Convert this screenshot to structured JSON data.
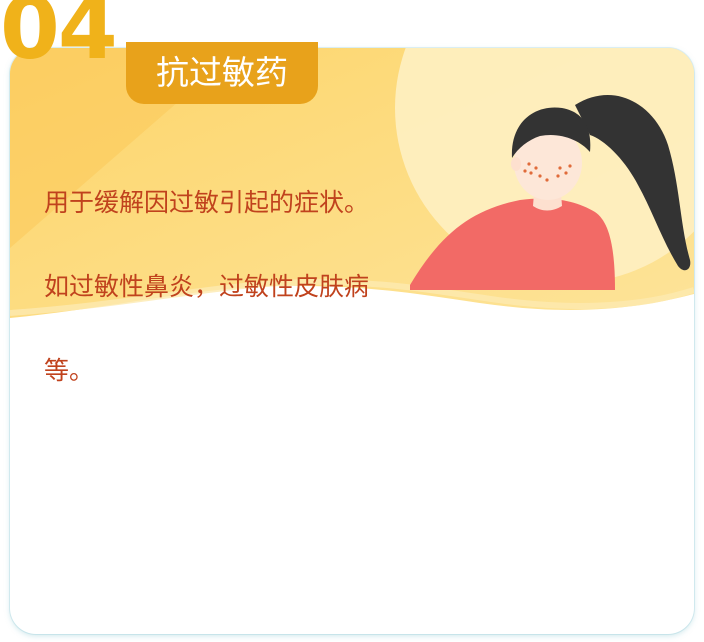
{
  "section": {
    "number": "04",
    "title": "抗过敏药",
    "description_lines": [
      "用于缓解因过敏引起的症状。",
      "如过敏性鼻炎，过敏性皮肤病",
      "等。"
    ]
  },
  "colors": {
    "number": "#f0b21a",
    "tag_background": "#e8a21b",
    "tag_text": "#ffffff",
    "description_text": "#c0421d",
    "banner_yellow": "#fdd56b",
    "shirt": "#f26a66",
    "hair": "#333333"
  },
  "icons": {
    "illustration": "girl-with-freckles-illustration"
  }
}
